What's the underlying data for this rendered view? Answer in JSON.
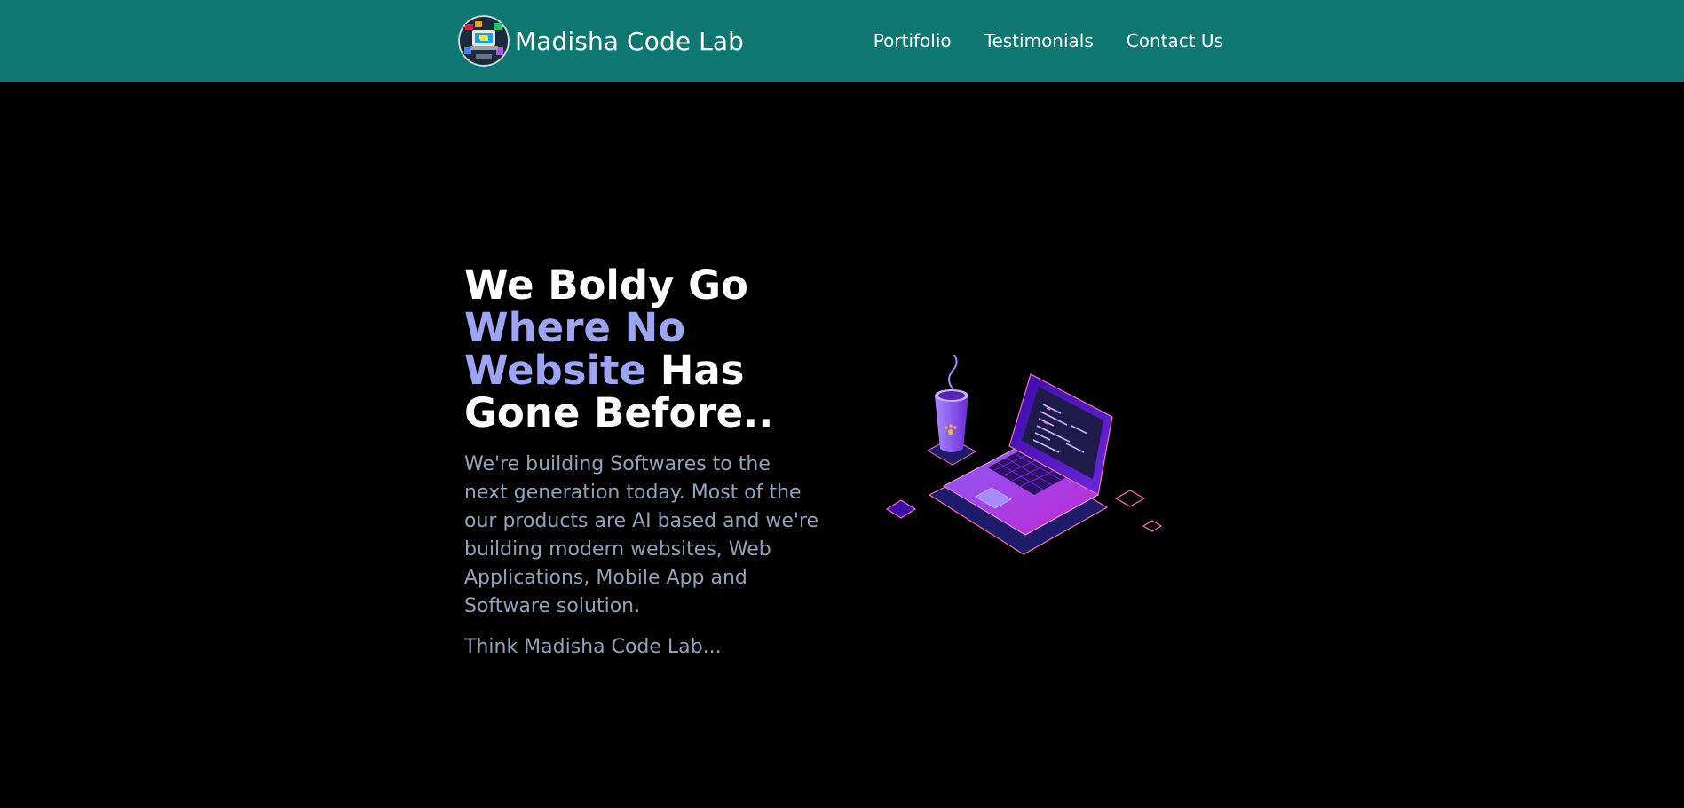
{
  "brand": {
    "name": "Madisha Code Lab",
    "logo_icon": "laptop-logo-icon"
  },
  "nav": {
    "links": [
      {
        "label": "Portifolio"
      },
      {
        "label": "Testimonials"
      },
      {
        "label": "Contact Us"
      }
    ]
  },
  "hero": {
    "title": {
      "line1": "We Boldy Go",
      "highlight": "Where No Website",
      "rest": "Has",
      "line_end": "Gone Before.."
    },
    "description": "We're building Softwares to the next generation today. Most of the our products are AI based and we're building modern websites, Web Applications, Mobile App and Software solution.",
    "tagline": "Think Madisha Code Lab...",
    "illustration_icon": "laptop-coffee-illustration-icon"
  },
  "colors": {
    "navbar": "#0f7771",
    "background": "#000000",
    "highlight": "#9da4f4",
    "muted_text": "#94a3b8",
    "illustration_purple": "#7c3aed",
    "illustration_pink": "#f472b6"
  }
}
